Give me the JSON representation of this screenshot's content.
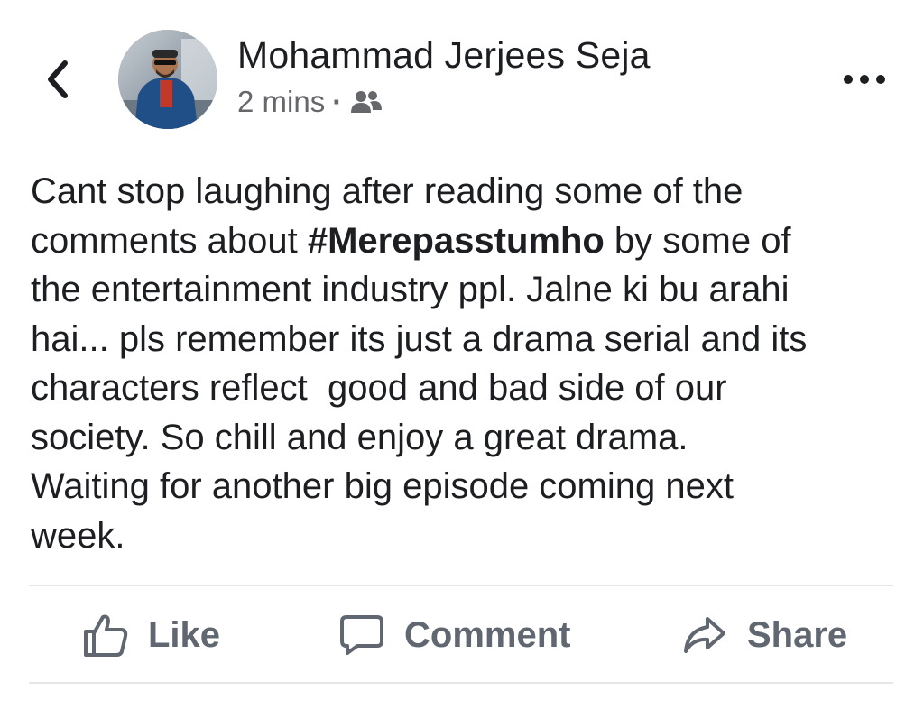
{
  "post": {
    "author": "Mohammad Jerjees Seja",
    "time": "2 mins",
    "separator": "·",
    "audience_icon": "friends-icon",
    "text_lines": [
      [
        "Cant stop laughing after reading some of the"
      ],
      [
        "comments about ",
        "#Merepasstumho",
        " by some of"
      ],
      [
        "the entertainment industry ppl. Jalne ki bu arahi"
      ],
      [
        "hai... pls remember its just a drama serial and its"
      ],
      [
        "characters reflect  good and bad side of our"
      ],
      [
        "society. So chill and enjoy a great drama."
      ],
      [
        "Waiting for another big episode coming next"
      ],
      [
        "week."
      ]
    ]
  },
  "actions": {
    "like": "Like",
    "comment": "Comment",
    "share": "Share"
  },
  "icons": {
    "back": "chevron-left-icon",
    "more": "more-options-icon",
    "like": "thumbs-up-icon",
    "comment": "speech-bubble-icon",
    "share": "share-arrow-icon"
  },
  "colors": {
    "text": "#1c1e21",
    "secondary": "#65676b",
    "action": "#606770",
    "divider": "#e4e6ea"
  }
}
